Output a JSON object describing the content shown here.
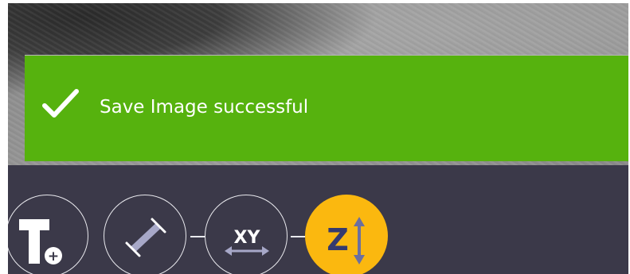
{
  "notification": {
    "message": "Save Image successful",
    "status": "success",
    "color": "#56b20e",
    "icon": "checkmark-icon"
  },
  "toolbar": {
    "background": "#3b3949",
    "tools": [
      {
        "id": "add-text",
        "icon": "text-plus-icon",
        "glyph": "T",
        "badge": "+",
        "active": false
      },
      {
        "id": "measure-distance",
        "icon": "measure-line-icon",
        "active": false
      },
      {
        "id": "measure-xy",
        "icon": "xy-arrow-icon",
        "glyph": "XY",
        "active": false
      },
      {
        "id": "measure-z",
        "icon": "z-arrow-icon",
        "glyph": "Z",
        "active": true,
        "color": "#fbb80f"
      }
    ]
  }
}
